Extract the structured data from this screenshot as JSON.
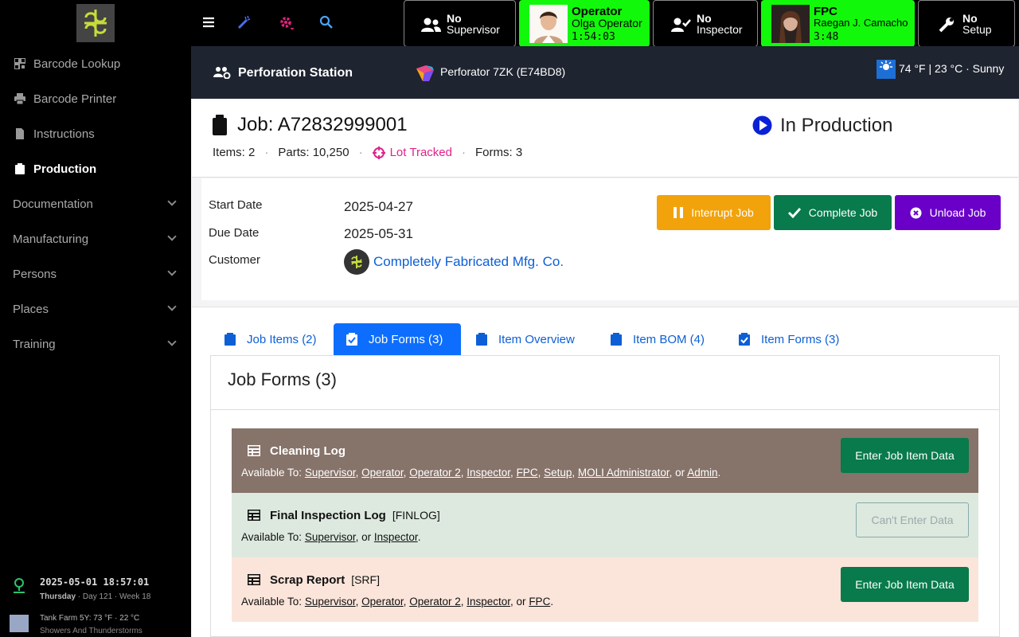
{
  "sidebar": {
    "items": [
      {
        "label": "Barcode Lookup",
        "icon": "barcode-icon"
      },
      {
        "label": "Barcode Printer",
        "icon": "printer-icon"
      },
      {
        "label": "Instructions",
        "icon": "file-icon"
      },
      {
        "label": "Production",
        "icon": "clipboard-icon",
        "active": true
      }
    ],
    "groups": [
      "Documentation",
      "Manufacturing",
      "Persons",
      "Places",
      "Training"
    ],
    "datetime": "2025-05-01 18:57:01",
    "weekday": "Thursday",
    "day": "Day 121",
    "week": "Week 18",
    "tank_name": "Tank Farm 5Y:",
    "tank_temp": "73 °F · 22 °C",
    "tank_weather": "Showers And Thunderstorms"
  },
  "roles": {
    "supervisor": {
      "line1": "No",
      "line2": "Supervisor"
    },
    "operator": {
      "title": "Operator",
      "name": "Olga Operator",
      "timer": "1:54:03"
    },
    "inspector": {
      "line1": "No",
      "line2": "Inspector"
    },
    "fpc": {
      "title": "FPC",
      "name": "Raegan J. Camacho",
      "timer": "3:48"
    },
    "setup": {
      "line1": "No",
      "line2": "Setup"
    }
  },
  "station": {
    "name": "Perforation Station",
    "machine": "Perforator 7ZK (E74BD8)",
    "weather": "74 °F | 23 °C · Sunny"
  },
  "job": {
    "title": "Job: A72832999001",
    "items": "Items: 2",
    "parts": "Parts: 10,250",
    "lot": "Lot Tracked",
    "forms": "Forms: 3",
    "status": "In Production",
    "start_label": "Start Date",
    "start_value": "2025-04-27",
    "due_label": "Due Date",
    "due_value": "2025-05-31",
    "customer_label": "Customer",
    "customer_value": "Completely Fabricated Mfg. Co."
  },
  "actions": {
    "interrupt": "Interrupt Job",
    "complete": "Complete Job",
    "unload": "Unload Job"
  },
  "tabs": [
    {
      "label": "Job Items (2)"
    },
    {
      "label": "Job Forms (3)",
      "active": true
    },
    {
      "label": "Item Overview"
    },
    {
      "label": "Item BOM (4)"
    },
    {
      "label": "Item Forms (3)"
    }
  ],
  "forms_panel": {
    "title": "Job Forms (3)",
    "available_prefix": "Available To:",
    "forms": [
      {
        "name": "Cleaning Log",
        "code": "",
        "roles": [
          "Supervisor",
          "Operator",
          "Operator 2",
          "Inspector",
          "FPC",
          "Setup",
          "MOLI Administrator",
          "Admin"
        ],
        "button": "Enter Job Item Data",
        "color": "#86736a"
      },
      {
        "name": "Final Inspection Log",
        "code": "[FINLOG]",
        "roles": [
          "Supervisor",
          "Inspector"
        ],
        "button": "Can't Enter Data",
        "color": "#dde9df"
      },
      {
        "name": "Scrap Report",
        "code": "[SRF]",
        "roles": [
          "Supervisor",
          "Operator",
          "Operator 2",
          "Inspector",
          "FPC"
        ],
        "button": "Enter Job Item Data",
        "color": "#fbe5da"
      }
    ]
  },
  "colors": {
    "accent": "#0d6efd",
    "green_btn": "#087a4b",
    "orange_btn": "#f2a20b",
    "purple_btn": "#6a00c8",
    "lot": "#e0228a"
  }
}
